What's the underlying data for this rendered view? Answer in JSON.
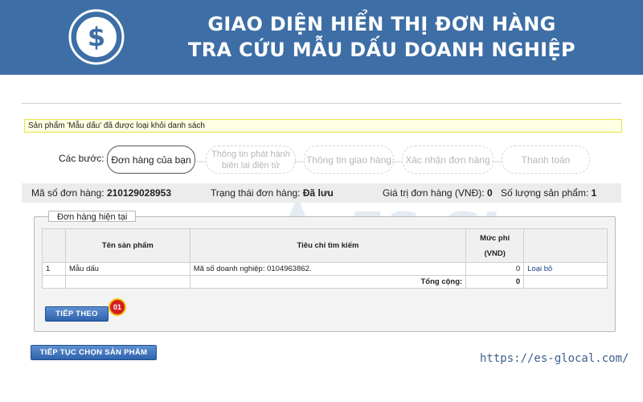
{
  "banner": {
    "title_line1": "GIAO DIỆN HIỂN THỊ ĐƠN HÀNG",
    "title_line2": "TRA CỨU MẪU DẤU DOANH NGHIỆP",
    "logo_glyph": "$",
    "logo_icon": "dollar-coin-logo-icon"
  },
  "watermark": {
    "text": "ES GLOCAL"
  },
  "notice": "Sản phẩm 'Mẫu dấu' đã được loại khỏi danh sách",
  "steps": {
    "label": "Các bước:",
    "items": [
      {
        "label": "Đơn hàng của bạn",
        "active": true
      },
      {
        "label": "Thông tin phát hành biên lai điện tử",
        "active": false
      },
      {
        "label": "Thông tin giao hàng",
        "active": false
      },
      {
        "label": "Xác nhận đơn hàng",
        "active": false
      },
      {
        "label": "Thanh toán",
        "active": false
      }
    ]
  },
  "order_info": {
    "order_id_label": "Mã số đơn hàng:",
    "order_id": "210129028953",
    "status_label": "Trạng thái đơn hàng:",
    "status": "Đã lưu",
    "value_label": "Giá trị đơn hàng (VNĐ):",
    "value": "0",
    "qty_label": "Số lượng sản phẩm:",
    "qty": "1"
  },
  "current_order": {
    "legend": "Đơn hàng hiện tại",
    "columns": [
      "",
      "Tên sản phẩm",
      "Tiêu chí tìm kiếm",
      "Mức phí",
      "(VND)",
      ""
    ],
    "rows": [
      {
        "index": "1",
        "product": "Mẫu dấu",
        "criteria": "Mã số doanh nghiệp: 0104963862.",
        "fee": "0",
        "action": "Loại bỏ"
      }
    ],
    "total_label": "Tổng cộng:",
    "total_value": "0"
  },
  "buttons": {
    "next": "TIẾP THEO",
    "next_badge": "01",
    "continue": "TIẾP TỤC CHỌN SẢN PHẨM"
  },
  "website": "https://es-glocal.com/",
  "colors": {
    "banner": "#3d6ea5",
    "notice_bg": "#ffffe3",
    "notice_border": "#e6e24a",
    "button": "#2f63ad",
    "badge": "#d51e1e"
  }
}
